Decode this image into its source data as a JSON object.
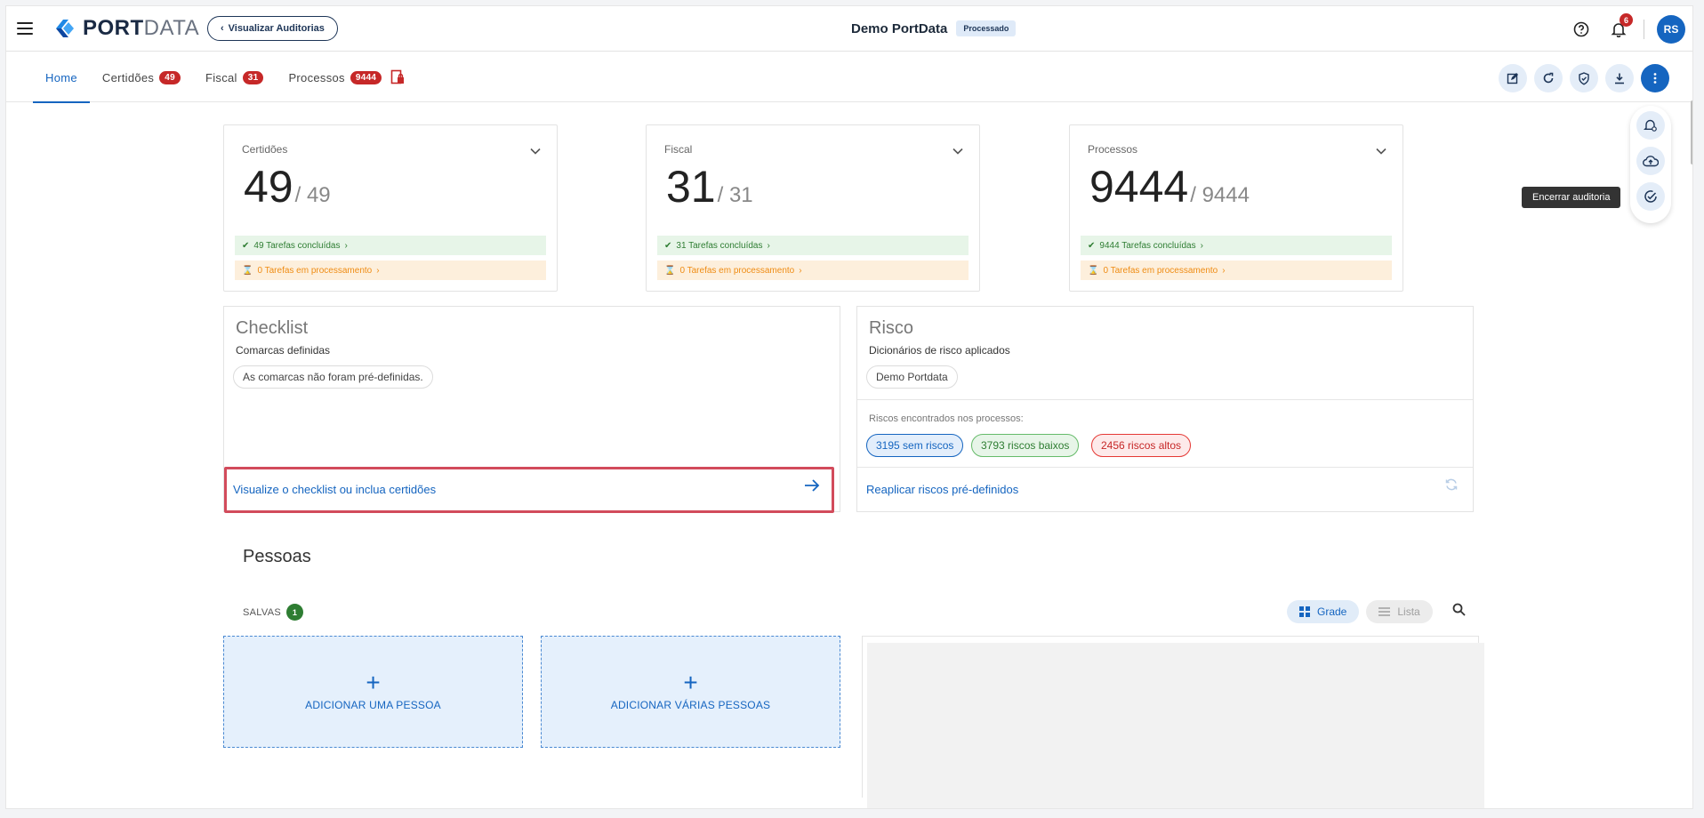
{
  "header": {
    "logo_text_bold": "PORT",
    "logo_text_light": "DATA",
    "back_button": "Visualizar Auditorias",
    "project_name": "Demo PortData",
    "status_badge": "Processado",
    "notification_count": "6",
    "avatar_initials": "RS"
  },
  "tabs": [
    {
      "label": "Home"
    },
    {
      "label": "Certidões",
      "count": "49"
    },
    {
      "label": "Fiscal",
      "count": "31"
    },
    {
      "label": "Processos",
      "count": "9444"
    }
  ],
  "tooltip": "Encerrar auditoria",
  "stats": [
    {
      "label": "Certidões",
      "value": "49",
      "total": "/ 49",
      "done": "49 Tarefas concluídas",
      "processing": "0 Tarefas em processamento"
    },
    {
      "label": "Fiscal",
      "value": "31",
      "total": "/ 31",
      "done": "31 Tarefas concluídas",
      "processing": "0 Tarefas em processamento"
    },
    {
      "label": "Processos",
      "value": "9444",
      "total": "/ 9444",
      "done": "9444 Tarefas concluídas",
      "processing": "0 Tarefas em processamento"
    }
  ],
  "checklist": {
    "title": "Checklist",
    "subtitle": "Comarcas definidas",
    "chip": "As comarcas não foram pré-definidas.",
    "link": "Visualize o checklist ou inclua certidões"
  },
  "risco": {
    "title": "Risco",
    "subtitle": "Dicionários de risco aplicados",
    "chip": "Demo Portdata",
    "found_label": "Riscos encontrados nos processos:",
    "none": "3195 sem riscos",
    "low": "3793 riscos baixos",
    "high": "2456 riscos altos",
    "link": "Reaplicar riscos pré-definidos"
  },
  "pessoas": {
    "title": "Pessoas",
    "saved_label": "SALVAS",
    "saved_count": "1",
    "grid_label": "Grade",
    "list_label": "Lista",
    "add_one": "ADICIONAR UMA PESSOA",
    "add_many": "ADICIONAR VÁRIAS PESSOAS"
  },
  "colors": {
    "primary": "#1565c0",
    "danger": "#c62828",
    "success": "#2e7d32",
    "warning": "#ef8c14"
  }
}
